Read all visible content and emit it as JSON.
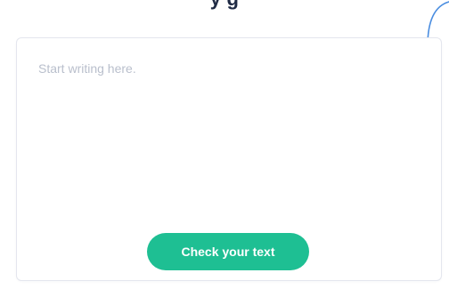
{
  "page": {
    "heading_partial": "y   g"
  },
  "editor": {
    "placeholder": "Start writing here.",
    "value": ""
  },
  "actions": {
    "check_label": "Check your text"
  },
  "colors": {
    "accent": "#1ebf93",
    "arrow": "#4a8de0",
    "card_border": "#e4e6ee",
    "placeholder": "#b9bfcc"
  },
  "icons": {
    "hint_arrow": "curved-arrow-down-icon"
  }
}
